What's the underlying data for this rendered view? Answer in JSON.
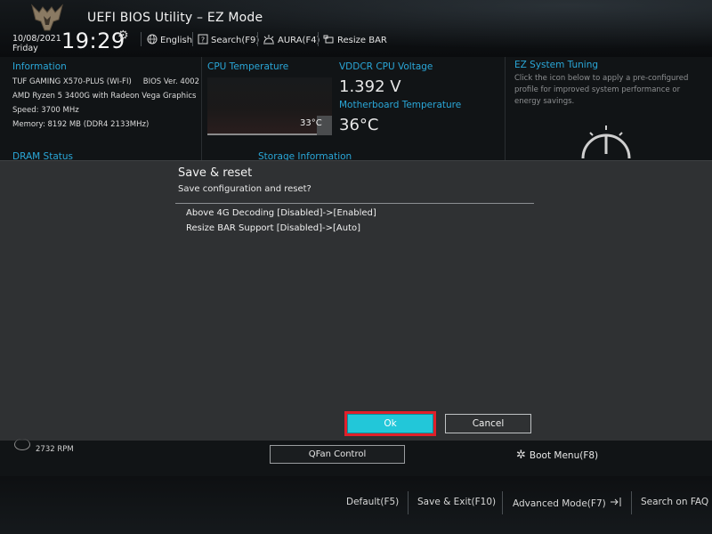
{
  "header": {
    "title": "UEFI BIOS Utility – EZ Mode",
    "date": "10/08/2021",
    "day": "Friday",
    "time": "19:29",
    "menu": {
      "language": "English",
      "search": "Search(F9)",
      "aura": "AURA(F4)",
      "resize_bar": "Resize BAR"
    }
  },
  "information": {
    "heading": "Information",
    "board": "TUF GAMING X570-PLUS (WI-FI)",
    "bios": "BIOS Ver. 4002",
    "cpu": "AMD Ryzen 5 3400G with Radeon Vega Graphics",
    "speed": "Speed: 3700 MHz",
    "memory": "Memory: 8192 MB (DDR4 2133MHz)"
  },
  "cpu_temperature": {
    "heading": "CPU Temperature",
    "value": "33°C"
  },
  "voltage": {
    "heading": "VDDCR CPU Voltage",
    "value": "1.392 V"
  },
  "mb_temperature": {
    "heading": "Motherboard Temperature",
    "value": "36°C"
  },
  "ez_tuning": {
    "heading": "EZ System Tuning",
    "description": "Click the icon below to apply a pre-configured profile for improved system performance or energy savings."
  },
  "dram_status": {
    "heading": "DRAM Status"
  },
  "storage_info": {
    "heading": "Storage Information"
  },
  "dialog": {
    "title": "Save & reset",
    "subtitle": "Save configuration and reset?",
    "changes": [
      "Above 4G Decoding [Disabled]->[Enabled]",
      "Resize BAR Support [Disabled]->[Auto]"
    ],
    "ok_label": "Ok",
    "cancel_label": "Cancel"
  },
  "fan": {
    "rpm": "2732 RPM"
  },
  "qfan_label": "QFan Control",
  "boot_menu_label": "Boot Menu(F8)",
  "footer": {
    "default": "Default(F5)",
    "save_exit": "Save & Exit(F10)",
    "advanced": "Advanced Mode(F7)",
    "faq": "Search on FAQ"
  },
  "colors": {
    "accent": "#2aa7d8",
    "ok_button": "#22c7d9",
    "highlight": "#e0202a",
    "dialog_bg": "#2f3133"
  },
  "icons": [
    "logo-icon",
    "gear-icon",
    "globe-icon",
    "search-icon",
    "aura-icon",
    "resize-bar-icon",
    "gauge-icon",
    "fan-icon",
    "boot-menu-icon",
    "advanced-mode-icon"
  ]
}
